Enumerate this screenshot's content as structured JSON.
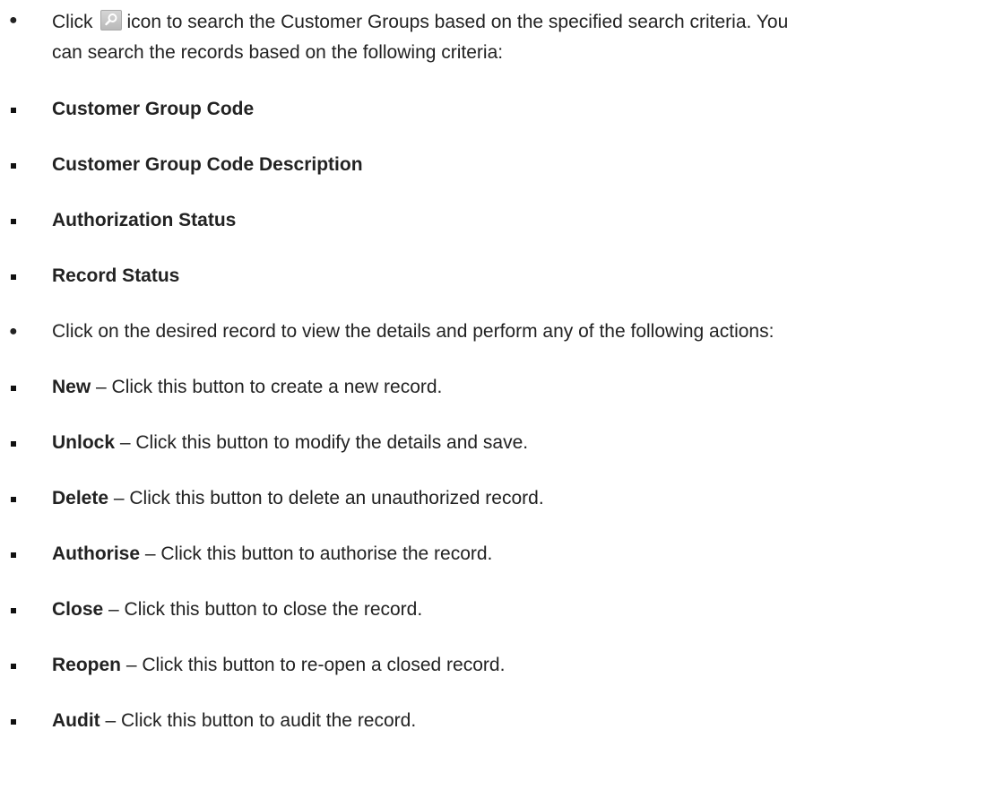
{
  "intro": {
    "before_icon": "Click",
    "icon": "search-icon",
    "after_icon": "icon to search the Customer Groups based on the specified search criteria. You",
    "continuation": "can search the records based on the following criteria:"
  },
  "criteria": [
    "Customer Group Code",
    "Customer Group Code Description",
    "Authorization Status",
    "Record Status"
  ],
  "actions_intro": "Click on the desired record to view the details and perform any of the following actions:",
  "actions": [
    {
      "name": "New",
      "desc": " – Click this button to create a new record."
    },
    {
      "name": "Unlock",
      "desc": " – Click this button to modify the details and save."
    },
    {
      "name": "Delete",
      "desc": " – Click this button to delete an unauthorized record."
    },
    {
      "name": "Authorise",
      "desc": " – Click this button to authorise the record."
    },
    {
      "name": "Close",
      "desc": " – Click this button to close the record."
    },
    {
      "name": "Reopen",
      "desc": " – Click this button to re-open a closed record."
    },
    {
      "name": "Audit",
      "desc": " – Click this button to audit the record."
    }
  ]
}
